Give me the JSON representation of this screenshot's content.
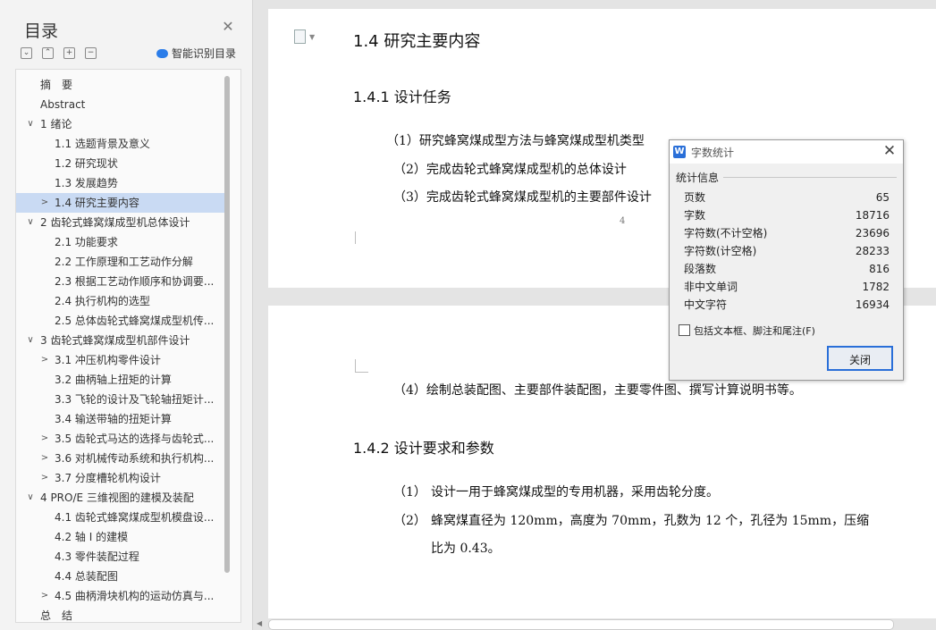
{
  "sidebar": {
    "title": "目录",
    "smart_toc_label": "智能识别目录",
    "toolbar_buttons": [
      "⌄",
      "⌃",
      "+",
      "−"
    ],
    "items": [
      {
        "label": "摘　要",
        "level": 0,
        "chevron": ""
      },
      {
        "label": "Abstract",
        "level": 0,
        "chevron": ""
      },
      {
        "label": "1 绪论",
        "level": 0,
        "chevron": "∨"
      },
      {
        "label": "1.1 选题背景及意义",
        "level": 1,
        "chevron": ""
      },
      {
        "label": "1.2 研究现状",
        "level": 1,
        "chevron": ""
      },
      {
        "label": "1.3 发展趋势",
        "level": 1,
        "chevron": ""
      },
      {
        "label": "1.4 研究主要内容",
        "level": 1,
        "chevron": ">",
        "selected": true
      },
      {
        "label": "2 齿轮式蜂窝煤成型机总体设计",
        "level": 0,
        "chevron": "∨"
      },
      {
        "label": "2.1 功能要求",
        "level": 1,
        "chevron": ""
      },
      {
        "label": "2.2 工作原理和工艺动作分解",
        "level": 1,
        "chevron": ""
      },
      {
        "label": "2.3  根据工艺动作顺序和协调要...",
        "level": 1,
        "chevron": ""
      },
      {
        "label": "2.4 执行机构的选型",
        "level": 1,
        "chevron": ""
      },
      {
        "label": "2.5 总体齿轮式蜂窝煤成型机传...",
        "level": 1,
        "chevron": ""
      },
      {
        "label": "3 齿轮式蜂窝煤成型机部件设计",
        "level": 0,
        "chevron": "∨"
      },
      {
        "label": "3.1 冲压机构零件设计",
        "level": 1,
        "chevron": ">"
      },
      {
        "label": "3.2 曲柄轴上扭矩的计算",
        "level": 1,
        "chevron": ""
      },
      {
        "label": "3.3 飞轮的设计及飞轮轴扭矩计...",
        "level": 1,
        "chevron": ""
      },
      {
        "label": "3.4 输送带轴的扭矩计算",
        "level": 1,
        "chevron": ""
      },
      {
        "label": "3.5 齿轮式马达的选择与齿轮式...",
        "level": 1,
        "chevron": ">"
      },
      {
        "label": "3.6 对机械传动系统和执行机构...",
        "level": 1,
        "chevron": ">"
      },
      {
        "label": "3.7 分度槽轮机构设计",
        "level": 1,
        "chevron": ">"
      },
      {
        "label": "4 PRO/E 三维视图的建模及装配",
        "level": 0,
        "chevron": "∨"
      },
      {
        "label": "4.1 齿轮式蜂窝煤成型机模盘设...",
        "level": 1,
        "chevron": ""
      },
      {
        "label": "4.2 轴 I 的建模",
        "level": 1,
        "chevron": ""
      },
      {
        "label": "4.3 零件装配过程",
        "level": 1,
        "chevron": ""
      },
      {
        "label": "4.4 总装配图",
        "level": 1,
        "chevron": ""
      },
      {
        "label": "4.5 曲柄滑块机构的运动仿真与...",
        "level": 1,
        "chevron": ">"
      },
      {
        "label": "总　结",
        "level": 0,
        "chevron": ""
      }
    ]
  },
  "document": {
    "page1": {
      "heading": "1.4 研究主要内容",
      "subheading": "1.4.1 设计任务",
      "lines": [
        "（1）研究蜂窝煤成型方法与蜂窝煤成型机类型",
        "（2）完成齿轮式蜂窝煤成型机的总体设计",
        "（3）完成齿轮式蜂窝煤成型机的主要部件设计"
      ],
      "page_number": "4"
    },
    "page2": {
      "line4": "（4）绘制总装配图、主要部件装配图，主要零件图、撰写计算说明书等。",
      "subheading": "1.4.2 设计要求和参数",
      "req1_num": "（1）",
      "req1_text": "设计一用于蜂窝煤成型的专用机器，采用齿轮分度。",
      "req2_num": "（2）",
      "req2_text": "蜂窝煤直径为 120mm，高度为 70mm，孔数为 12 个，孔径为 15mm，压缩",
      "req2_cont": "比为 0.43。"
    }
  },
  "dialog": {
    "title": "字数统计",
    "section": "统计信息",
    "stats": [
      {
        "label": "页数",
        "value": "65"
      },
      {
        "label": "字数",
        "value": "18716"
      },
      {
        "label": "字符数(不计空格)",
        "value": "23696"
      },
      {
        "label": "字符数(计空格)",
        "value": "28233"
      },
      {
        "label": "段落数",
        "value": "816"
      },
      {
        "label": "非中文单词",
        "value": "1782"
      },
      {
        "label": "中文字符",
        "value": "16934"
      }
    ],
    "checkbox_label": "包括文本框、脚注和尾注(F)",
    "checkbox_checked": false,
    "close_button": "关闭"
  }
}
